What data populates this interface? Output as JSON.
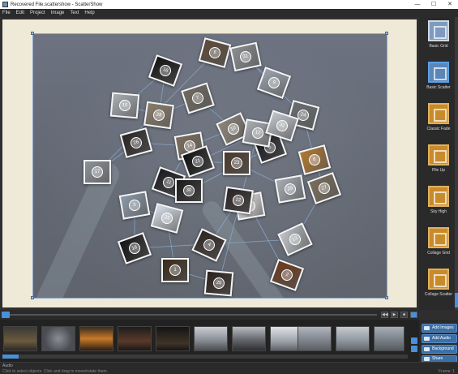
{
  "window": {
    "title": "Recovered File.scattershow - ScatterShow",
    "minimize": "—",
    "maximize": "☐",
    "close": "✕"
  },
  "menu": [
    "File",
    "Edit",
    "Project",
    "Image",
    "Text",
    "Help"
  ],
  "tiles": [
    {
      "n": "1"
    },
    {
      "n": "2"
    },
    {
      "n": "3"
    },
    {
      "n": "4"
    },
    {
      "n": "5"
    },
    {
      "n": "6"
    },
    {
      "n": "7"
    },
    {
      "n": "8"
    },
    {
      "n": "9"
    },
    {
      "n": "10"
    },
    {
      "n": "11"
    },
    {
      "n": "12"
    },
    {
      "n": "13"
    },
    {
      "n": "14"
    },
    {
      "n": "15"
    },
    {
      "n": "16"
    },
    {
      "n": "17"
    },
    {
      "n": "18"
    },
    {
      "n": "19"
    },
    {
      "n": "20"
    },
    {
      "n": "21"
    },
    {
      "n": "22"
    },
    {
      "n": "23"
    },
    {
      "n": "24"
    },
    {
      "n": "25"
    },
    {
      "n": "26"
    },
    {
      "n": "27"
    },
    {
      "n": "28"
    },
    {
      "n": "29"
    },
    {
      "n": "30"
    },
    {
      "n": "31"
    },
    {
      "n": "32"
    }
  ],
  "templates": [
    {
      "label": "Basic Grid",
      "style": "blue"
    },
    {
      "label": "Basic Scatter",
      "style": "selected"
    },
    {
      "label": "Classic Fade",
      "style": "gold"
    },
    {
      "label": "Pile Up",
      "style": "gold"
    },
    {
      "label": "Sky High",
      "style": "gold"
    },
    {
      "label": "Collage Grid",
      "style": "gold"
    },
    {
      "label": "Collage Scatter",
      "style": "gold"
    }
  ],
  "actions": {
    "add_images": "Add Images",
    "add_audio": "Add Audio",
    "background": "Background",
    "share": "Share"
  },
  "status": {
    "audio_label": "Audio",
    "hint": "Click to select objects. Click and drag to move/rotate them.",
    "frames": "Frame: 1"
  },
  "colors": {
    "accent": "#4a90d9",
    "canvas": "#efe9d7",
    "panel": "#2a2a2a"
  }
}
